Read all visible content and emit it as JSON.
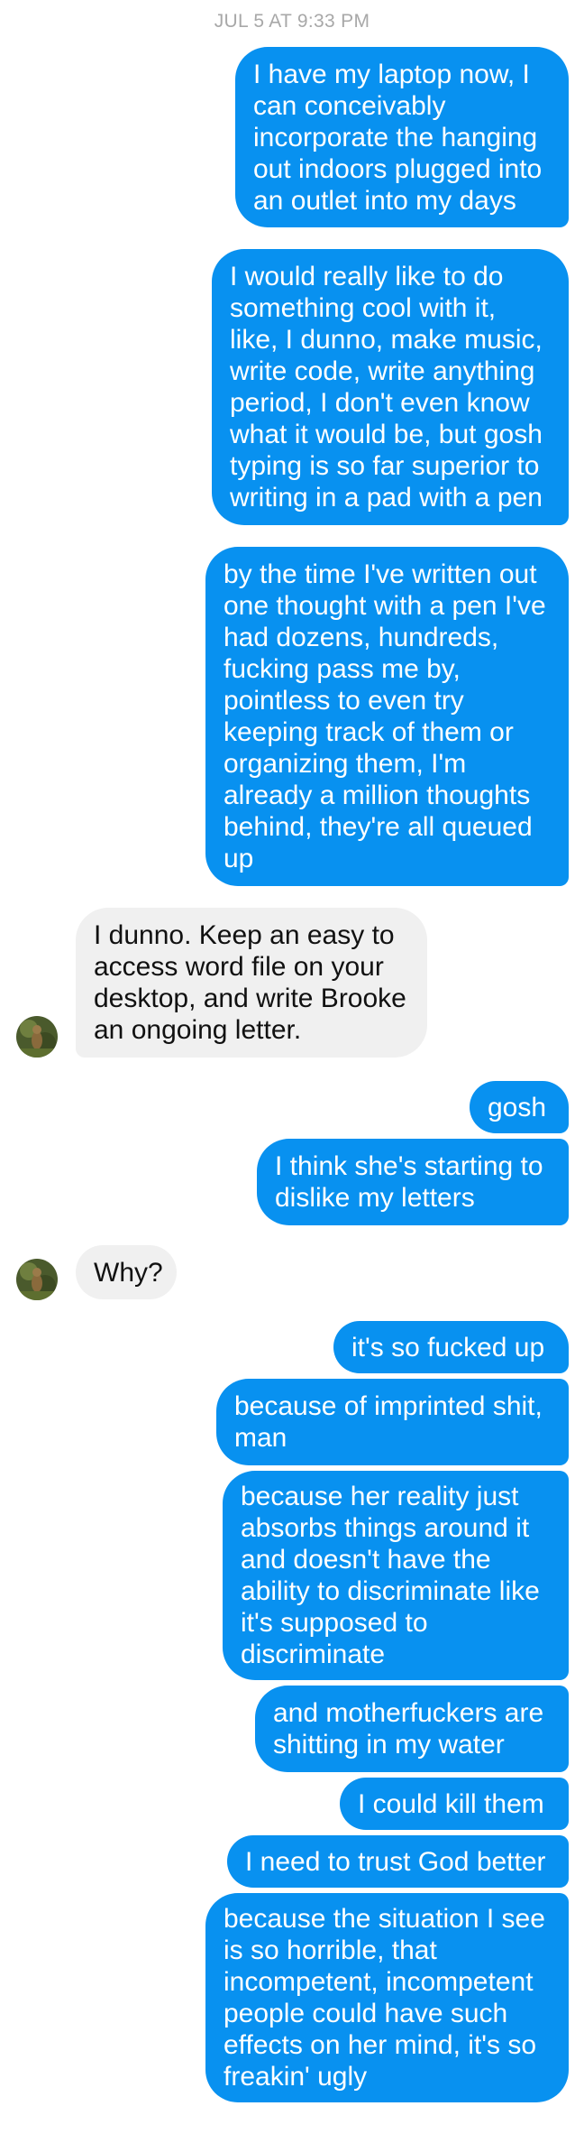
{
  "header": {
    "timestamp": "JUL 5 AT 9:33 PM"
  },
  "colors": {
    "sent_bubble": "#0891f0",
    "received_bubble": "#f0f0f0"
  },
  "messages": [
    {
      "from": "me",
      "text": "I have my laptop now, I\ncan conceivably\nincorporate the hanging\nout indoors plugged into\nan outlet into my days"
    },
    {
      "from": "me",
      "text": "I would really like to do\nsomething cool with it,\nlike, I dunno, make music,\nwrite code, write anything\nperiod, I don't even know\nwhat it would be, but gosh\ntyping is so far superior to\nwriting in a pad with a pen"
    },
    {
      "from": "me",
      "text": "by the time I've written out\none thought with a pen I've\nhad dozens, hundreds,\nfucking pass me by,\npointless to even try\nkeeping track of them or\norganizing them, I'm\nalready a million thoughts\nbehind, they're all queued\nup"
    },
    {
      "from": "them",
      "text": "I dunno. Keep an easy to\naccess word file on your\ndesktop, and write Brooke\nan ongoing letter."
    },
    {
      "from": "me",
      "text": "gosh"
    },
    {
      "from": "me",
      "text": "I think she's starting to\ndislike my letters"
    },
    {
      "from": "them",
      "text": "Why?"
    },
    {
      "from": "me",
      "text": "it's so fucked up"
    },
    {
      "from": "me",
      "text": "because of imprinted shit,\nman"
    },
    {
      "from": "me",
      "text": "because her reality just\nabsorbs things around it\nand doesn't have the\nability to discriminate like\nit's supposed to\ndiscriminate"
    },
    {
      "from": "me",
      "text": "and motherfuckers are\nshitting in my water"
    },
    {
      "from": "me",
      "text": "I could kill them"
    },
    {
      "from": "me",
      "text": "I need to trust God better"
    },
    {
      "from": "me",
      "text": "because the situation I see\nis so horrible, that\nincompetent, incompetent\npeople could have such\neffects on her mind, it's so\nfreakin' ugly"
    }
  ]
}
